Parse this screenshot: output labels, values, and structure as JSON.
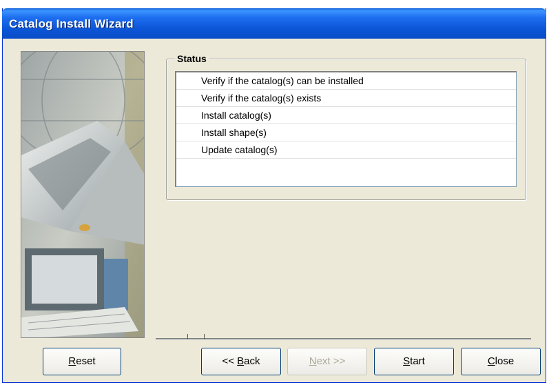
{
  "window": {
    "title": "Catalog Install Wizard"
  },
  "status": {
    "legend": "Status",
    "items": [
      "Verify if the catalog(s) can be installed",
      "Verify if the catalog(s) exists",
      "Install catalog(s)",
      "Install shape(s)",
      "Update catalog(s)"
    ]
  },
  "buttons": {
    "reset": {
      "first": "R",
      "rest": "eset"
    },
    "back": {
      "pre": "<< ",
      "first": "B",
      "rest": "ack"
    },
    "next": {
      "first": "N",
      "rest": "ext >>",
      "enabled": false
    },
    "start": {
      "first": "S",
      "rest": "tart"
    },
    "close": {
      "first": "C",
      "rest": "lose"
    }
  },
  "colors": {
    "titlebar": "#0b55d6",
    "dialog_bg": "#ece9d8",
    "list_border": "#7f9db9"
  },
  "icons": [
    "wizard-side-illustration"
  ]
}
